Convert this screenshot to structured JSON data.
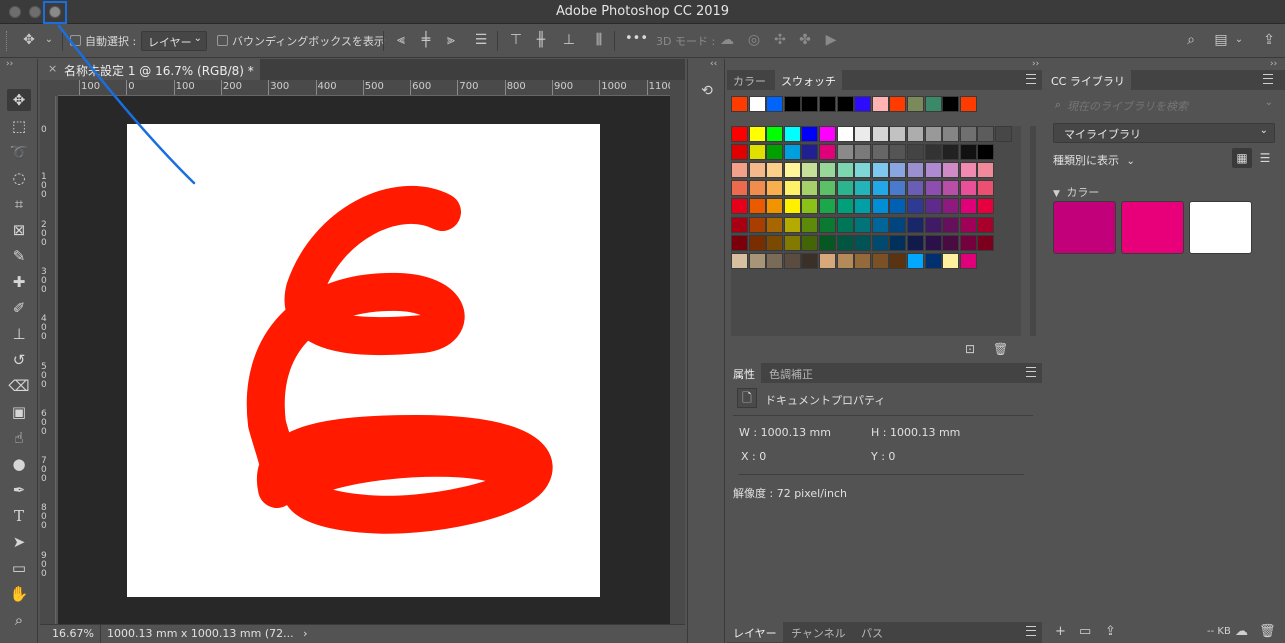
{
  "window": {
    "title": "Adobe Photoshop CC 2019"
  },
  "options_bar": {
    "move_tool_icon": "move-icon",
    "auto_select_label": "自動選択 :",
    "auto_select_target": "レイヤー",
    "bounding_box_label": "バウンディングボックスを表示",
    "more_label": "•••",
    "mode_3d_label": "3D モード :",
    "search_icon": "search-icon",
    "workspace_icon": "workspace-icon",
    "share_icon": "share-icon"
  },
  "tools": [
    {
      "name": "move-tool",
      "icon": "✥"
    },
    {
      "name": "marquee-tool",
      "icon": "⬚"
    },
    {
      "name": "lasso-tool",
      "icon": "➰"
    },
    {
      "name": "quick-select-tool",
      "icon": "◌"
    },
    {
      "name": "crop-tool",
      "icon": "⌗"
    },
    {
      "name": "frame-tool",
      "icon": "⊠"
    },
    {
      "name": "eyedropper-tool",
      "icon": "✎"
    },
    {
      "name": "healing-brush-tool",
      "icon": "✚"
    },
    {
      "name": "brush-tool",
      "icon": "✐"
    },
    {
      "name": "stamp-tool",
      "icon": "⊥"
    },
    {
      "name": "history-brush-tool",
      "icon": "↺"
    },
    {
      "name": "eraser-tool",
      "icon": "⌫"
    },
    {
      "name": "gradient-tool",
      "icon": "▣"
    },
    {
      "name": "smudge-tool",
      "icon": "☝"
    },
    {
      "name": "dodge-tool",
      "icon": "●"
    },
    {
      "name": "pen-tool",
      "icon": "✒"
    },
    {
      "name": "type-tool",
      "icon": "T"
    },
    {
      "name": "path-select-tool",
      "icon": "➤"
    },
    {
      "name": "rectangle-tool",
      "icon": "▭"
    },
    {
      "name": "hand-tool",
      "icon": "✋"
    },
    {
      "name": "zoom-tool",
      "icon": "⌕"
    }
  ],
  "document": {
    "tab_close": "×",
    "tab_label": "名称未設定 1 @ 16.7% (RGB/8) *",
    "ruler_top": [
      "100",
      "0",
      "100",
      "200",
      "300",
      "400",
      "500",
      "600",
      "700",
      "800",
      "900",
      "1000",
      "1100"
    ],
    "ruler_left": [
      "0",
      "100",
      "200",
      "300",
      "400",
      "500",
      "600",
      "700",
      "800",
      "900"
    ],
    "stroke_color": "#ff1a00"
  },
  "status": {
    "zoom": "16.67%",
    "doc_info": "1000.13 mm x 1000.13 mm (72...",
    "arrow": "›"
  },
  "swatches_panel": {
    "tabs": [
      "カラー",
      "スウォッチ"
    ],
    "active_tab": 1,
    "recent": [
      "#ff3b00",
      "#ffffff",
      "#0064ff",
      "#000000",
      "#000000",
      "#000000",
      "#000000",
      "#2d0bff",
      "#ffb3b3",
      "#ff3b00",
      "#7b8a5a",
      "#3a8a6a",
      "#000000",
      "#ff3b00"
    ],
    "grid": [
      [
        "#ff0000",
        "#ffff00",
        "#00ff00",
        "#00ffff",
        "#0000ff",
        "#ff00ff",
        "#ffffff",
        "#ebebeb",
        "#d6d6d6",
        "#c2c2c2",
        "#adadad",
        "#999999",
        "#858585",
        "#707070",
        "#5c5c5c",
        "#474747"
      ],
      [
        "#e00000",
        "#e0e000",
        "#00a000",
        "#00a0e0",
        "#202090",
        "#e0007a",
        "#8a8a8a",
        "#7a7a7a",
        "#666666",
        "#555555",
        "#444444",
        "#333333",
        "#222222",
        "#111111",
        "#000000"
      ],
      [
        "#f2a08a",
        "#f5b88a",
        "#fbd08a",
        "#fff59a",
        "#c6e09a",
        "#99d69a",
        "#7ed6b0",
        "#7ed6d6",
        "#7ec8f0",
        "#8aa6e0",
        "#9a90d0",
        "#b08ad0",
        "#d08ac6",
        "#f08ab0",
        "#f08a9a"
      ],
      [
        "#ec6a4e",
        "#f08c4e",
        "#f8b04e",
        "#fff06a",
        "#a6d06a",
        "#5cc066",
        "#2cb48e",
        "#22b4b8",
        "#22a8e6",
        "#4a7acc",
        "#6a5eb4",
        "#8e4eb0",
        "#b84ea6",
        "#e8509a",
        "#ec5070"
      ],
      [
        "#e8001a",
        "#ec5a00",
        "#f29400",
        "#fff000",
        "#8ac21a",
        "#1aa84a",
        "#00a07a",
        "#00a0a6",
        "#008ed6",
        "#0060b4",
        "#2e3a94",
        "#5e2a8c",
        "#8e1a80",
        "#e0007a",
        "#e8003e"
      ],
      [
        "#a80012",
        "#a83e00",
        "#a86600",
        "#b4aa00",
        "#5e8a0a",
        "#0a7a30",
        "#007658",
        "#007478",
        "#00669a",
        "#004480",
        "#1a266a",
        "#401a66",
        "#66105c",
        "#a00058",
        "#a8002a"
      ],
      [
        "#7a000c",
        "#7a2e00",
        "#7a4a00",
        "#827a00",
        "#446408",
        "#065822",
        "#005640",
        "#005456",
        "#004a70",
        "#00305c",
        "#121a4c",
        "#2c104a",
        "#4a0a42",
        "#74003e",
        "#7a001e"
      ],
      [
        "#d6c0a0",
        "#a89478",
        "#7a6a58",
        "#5a4c40",
        "#3a3028",
        "#d6a87a",
        "#b48a5a",
        "#946a3a",
        "#7a5024",
        "#5a3410",
        "#00a8ff",
        "#003070",
        "#fff0a0",
        "#e0007a"
      ]
    ],
    "new_icon": "new-swatch-icon",
    "trash_icon": "trash-icon"
  },
  "properties_panel": {
    "tabs": [
      "属性",
      "色調補正"
    ],
    "active_tab": 0,
    "doc_title": "ドキュメントプロパティ",
    "w_label": "W : 1000.13 mm",
    "h_label": "H : 1000.13 mm",
    "x_label": "X : 0",
    "y_label": "Y : 0",
    "resolution_label": "解像度 : 72 pixel/inch"
  },
  "layers_tabs": {
    "tabs": [
      "レイヤー",
      "チャンネル",
      "パス"
    ],
    "active_tab": 0
  },
  "cc_panel": {
    "tab_label": "CC ライブラリ",
    "search_placeholder": "現在のライブラリを検索",
    "library_name": "マイライブラリ",
    "sort_label": "種類別に表示",
    "color_header": "カラー",
    "colors": [
      "#c2007a",
      "#e8007a",
      "#ffffff"
    ],
    "footer_kb": "-- KB"
  }
}
